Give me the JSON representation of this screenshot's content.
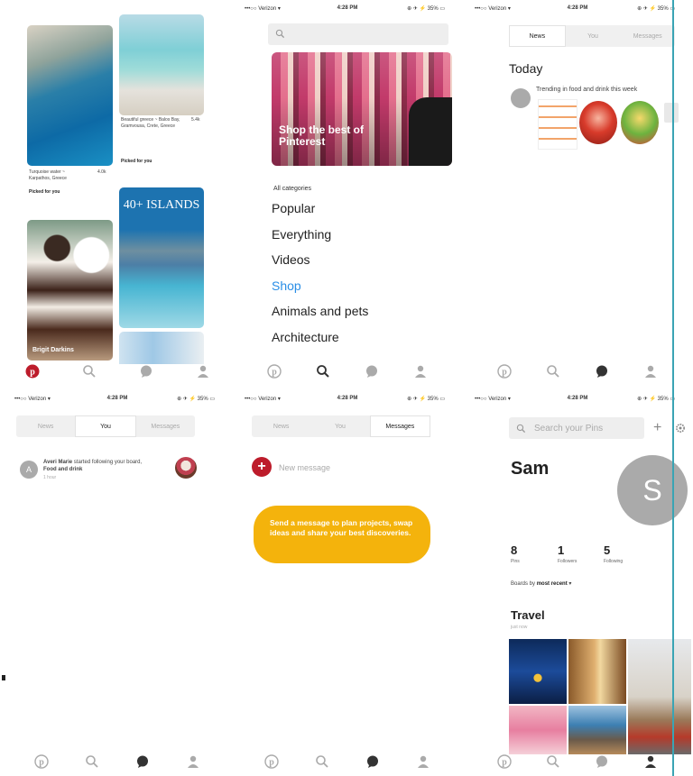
{
  "status_bar": {
    "carrier": "•••○○ Verizon ▾",
    "time": "4:28 PM",
    "battery": "⊕ ✈ ⚡ 35% ▭"
  },
  "screens": {
    "home_feed": {
      "pins": [
        {
          "caption": "Turquoise water ~ Karpathos, Greece",
          "meta": "4.0k",
          "sub": "Picked for you"
        },
        {
          "caption": "Beautiful greece ~ Balos Bay, Gramvousa, Crete, Greece",
          "meta": "5.4k",
          "sub": "Picked for you"
        },
        {
          "caption": "Brigit Darkins"
        },
        {
          "caption": "40+ ISLANDS"
        }
      ]
    },
    "search": {
      "feature_text": "Shop the best of Pinterest",
      "categories_header": "All categories",
      "categories": [
        "Popular",
        "Everything",
        "Videos",
        "Shop",
        "Animals and pets",
        "Architecture"
      ]
    },
    "news": {
      "tabs": [
        "News",
        "You",
        "Messages"
      ],
      "section": "Today",
      "trending": "Trending in food and drink this week"
    },
    "you": {
      "tabs": [
        "News",
        "You",
        "Messages"
      ],
      "avatar_letter": "A",
      "actor": "Averi Marie",
      "action": " started following your board, ",
      "board": "Food and drink",
      "time": "1 hour"
    },
    "messages": {
      "tabs": [
        "News",
        "You",
        "Messages"
      ],
      "new_message": "New message",
      "bubble": "Send a message to plan projects, swap ideas and share your best discoveries."
    },
    "profile": {
      "search_placeholder": "Search your Pins",
      "name": "Sam",
      "avatar_letter": "S",
      "stats": [
        {
          "n": "8",
          "label": "Pins"
        },
        {
          "n": "1",
          "label": "Followers"
        },
        {
          "n": "5",
          "label": "Following"
        }
      ],
      "boards_by_label": "Boards by ",
      "boards_by_value": "most recent",
      "boards_by_arrow": "▾",
      "board_title": "Travel",
      "board_sub": "just now"
    }
  },
  "colors": {
    "pinterest_red": "#bd1c2b",
    "accent_blue": "#2a8ee6",
    "bubble_yellow": "#f4b30c"
  }
}
